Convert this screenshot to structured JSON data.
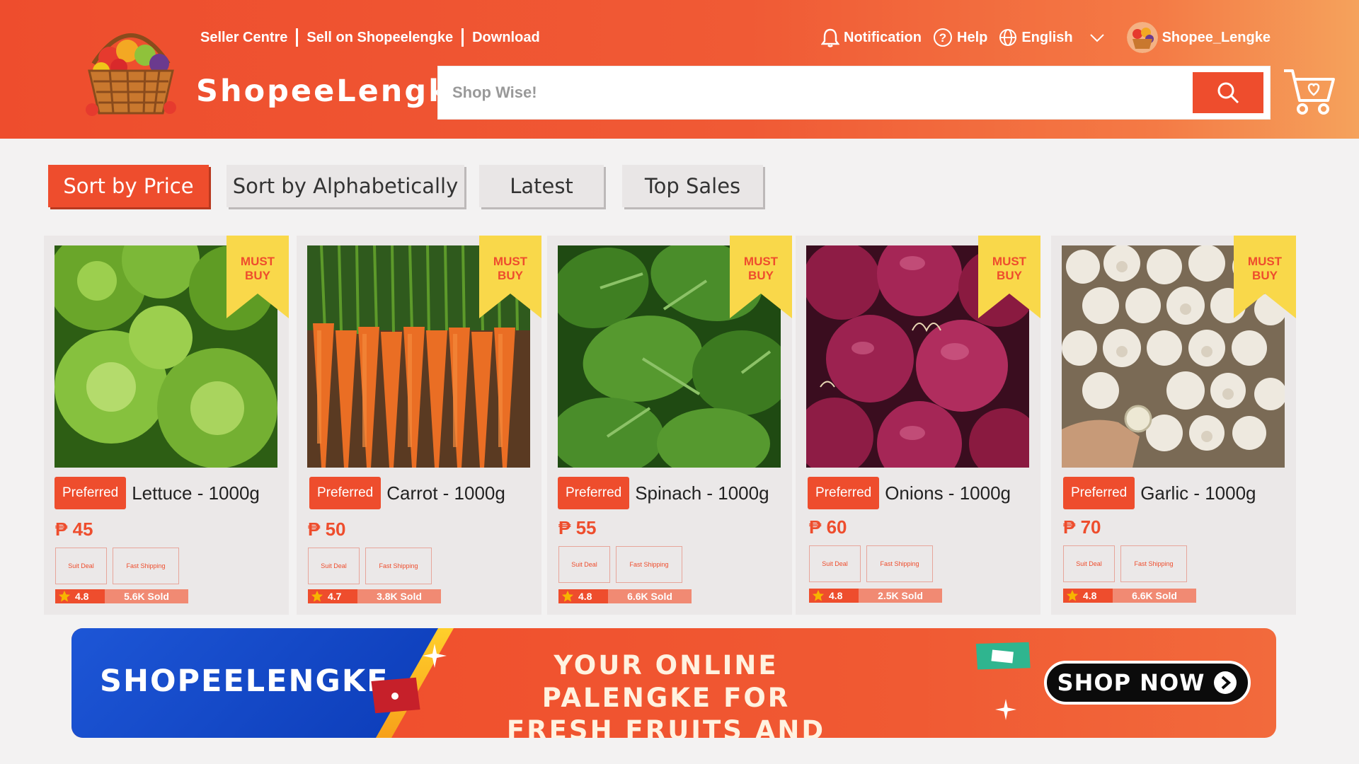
{
  "header": {
    "top_links": [
      "Seller Centre",
      "Sell on Shopeelengke",
      "Download"
    ],
    "notification_label": "Notification",
    "help_label": "Help",
    "language": "English",
    "username": "Shopee_Lengke",
    "brand": "ShopeeLengke",
    "search_placeholder": "Shop Wise!",
    "icons": [
      "bell-icon",
      "help-icon",
      "globe-icon",
      "chevron-down-icon",
      "search-icon",
      "cart-icon"
    ]
  },
  "sort": {
    "options": [
      "Sort by Price",
      "Sort by Alphabetically",
      "Latest",
      "Top Sales"
    ],
    "active": "Sort by Price"
  },
  "products": [
    {
      "badge": "Preferred",
      "name": "Lettuce - 1000g",
      "price": "₱ 45",
      "ribbon": [
        "MUST",
        "BUY"
      ],
      "tags": [
        "Suit Deal",
        "Fast Shipping"
      ],
      "rating": "4.8",
      "sold": "5.6K  Sold"
    },
    {
      "badge": "Preferred",
      "name": "Carrot - 1000g",
      "price": "₱ 50",
      "ribbon": [
        "MUST",
        "BUY"
      ],
      "tags": [
        "Suit Deal",
        "Fast Shipping"
      ],
      "rating": "4.7",
      "sold": "3.8K  Sold"
    },
    {
      "badge": "Preferred",
      "name": "Spinach - 1000g",
      "price": "₱ 55",
      "ribbon": [
        "MUST",
        "BUY"
      ],
      "tags": [
        "Suit Deal",
        "Fast Shipping"
      ],
      "rating": "4.8",
      "sold": "6.6K  Sold"
    },
    {
      "badge": "Preferred",
      "name": "Onions - 1000g",
      "price": "₱ 60",
      "ribbon": [
        "MUST",
        "BUY"
      ],
      "tags": [
        "Suit Deal",
        "Fast Shipping"
      ],
      "rating": "4.8",
      "sold": "2.5K  Sold"
    },
    {
      "badge": "Preferred",
      "name": "Garlic - 1000g",
      "price": "₱ 70",
      "ribbon": [
        "MUST",
        "BUY"
      ],
      "tags": [
        "Suit Deal",
        "Fast Shipping"
      ],
      "rating": "4.8",
      "sold": "6.6K  Sold"
    }
  ],
  "banner": {
    "brand": "SHOPEELENGKE",
    "message_line1": "YOUR ONLINE PALENGKE FOR",
    "message_line2": "FRESH FRUITS AND VEGGIES!",
    "cta": "SHOP NOW"
  },
  "colors": {
    "primary": "#ee4d2d",
    "ribbon": "#f9d84a",
    "banner_blue": "#1d56d6"
  }
}
